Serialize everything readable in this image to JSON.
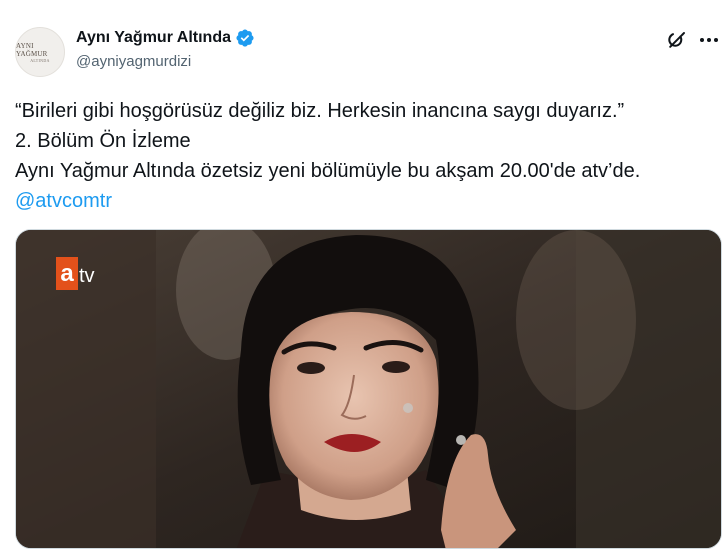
{
  "author": {
    "display_name": "Aynı Yağmur Altında",
    "handle": "@ayniyagmurdizi",
    "avatar_text_line1": "AYNI YAĞMUR",
    "avatar_text_line2": "ALTINDA",
    "verified": true
  },
  "tweet": {
    "lines": [
      "“Birileri gibi hoşgörüsüz değiliz biz. Herkesin inancına saygı duyarız.”",
      "2. Bölüm Ön İzleme",
      "Aynı Yağmur Altında özetsiz yeni bölümüyle bu akşam 20.00'de atv’de."
    ],
    "mention": "@atvcomtr"
  },
  "media": {
    "logo_a": "a",
    "logo_tv": "tv"
  },
  "icons": {
    "verified": "verified-badge-icon",
    "grok": "grok-icon",
    "more": "more-dots-icon"
  },
  "colors": {
    "accent": "#1d9bf0",
    "text": "#0f1419",
    "secondary": "#536471",
    "atv_orange": "#e3511b"
  }
}
